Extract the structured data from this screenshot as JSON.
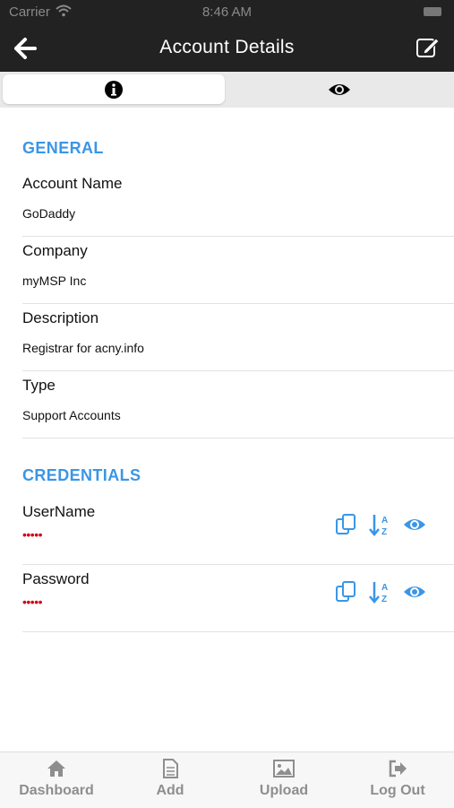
{
  "status_bar": {
    "carrier": "Carrier",
    "time": "8:46 AM"
  },
  "nav": {
    "title": "Account Details"
  },
  "segments": [
    {
      "icon": "info-icon"
    },
    {
      "icon": "eye-icon"
    }
  ],
  "general": {
    "heading": "GENERAL",
    "fields": [
      {
        "label": "Account Name",
        "value": "GoDaddy"
      },
      {
        "label": "Company",
        "value": "myMSP Inc"
      },
      {
        "label": "Description",
        "value": "Registrar for acny.info"
      },
      {
        "label": "Type",
        "value": "Support Accounts"
      }
    ]
  },
  "credentials": {
    "heading": "CREDENTIALS",
    "fields": [
      {
        "label": "UserName",
        "masked": "•••••"
      },
      {
        "label": "Password",
        "masked": "•••••"
      }
    ]
  },
  "tabbar": [
    {
      "label": "Dashboard",
      "icon": "home-icon"
    },
    {
      "label": "Add",
      "icon": "document-icon"
    },
    {
      "label": "Upload",
      "icon": "image-icon"
    },
    {
      "label": "Log Out",
      "icon": "logout-icon"
    }
  ],
  "colors": {
    "accent": "#3a96e6",
    "bar": "#222222",
    "mask": "#d0021b",
    "tab_text": "#8e8e8e"
  }
}
